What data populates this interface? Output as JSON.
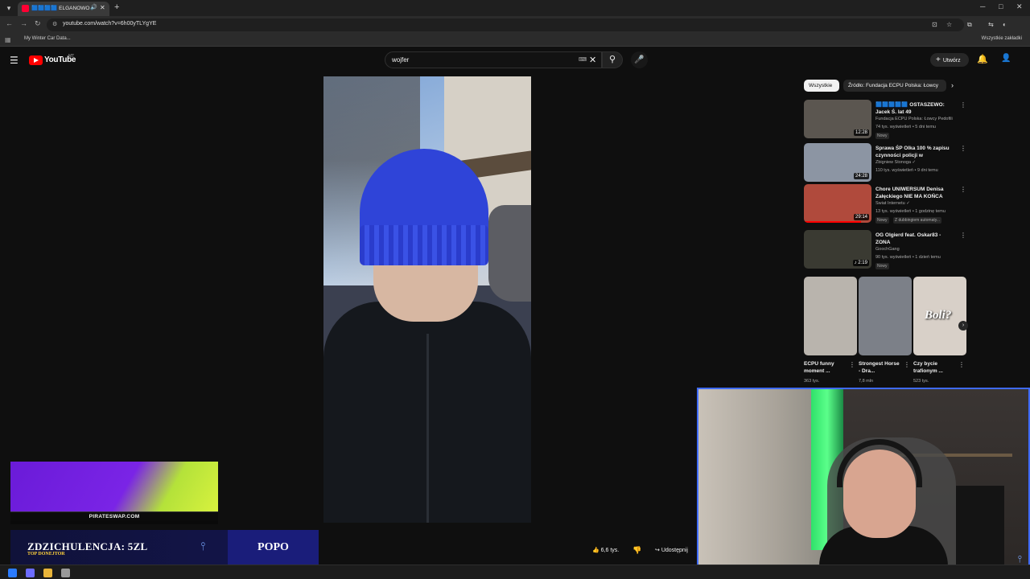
{
  "browser": {
    "tab_title": "🟦🟦🟦🟦 ELGANOWO",
    "url": "youtube.com/watch?v=6h00yTLYgYE",
    "bookmark_item": "My Winter Car Data...",
    "bookmarks_all": "Wszystkie zakładki",
    "icons": {
      "tab_menu": "▾",
      "tab_audio": "🔊",
      "tab_close": "✕",
      "new_tab": "+",
      "back": "←",
      "forward": "→",
      "reload": "↻",
      "site_info": "⚙",
      "install": "⊡",
      "star": "☆",
      "extensions": "⧉",
      "cast": "⇆",
      "profile": "◐",
      "minimize": "─",
      "maximize": "□",
      "close": "✕",
      "apps": "▦",
      "bookmark_folder": "▭"
    }
  },
  "youtube": {
    "logo_text": "YouTube",
    "country_code": "MT",
    "search_value": "wojfer",
    "create_label": "Utwórz",
    "icons": {
      "menu": "☰",
      "keyboard": "⌨",
      "clear": "✕",
      "search": "⚲",
      "mic": "🎤",
      "plus": "+",
      "bell": "🔔",
      "avatar": "👤"
    }
  },
  "actions": {
    "likes": "6,6 tys.",
    "share_label": "Udostępnij",
    "icons": {
      "like": "👍",
      "dislike": "👎",
      "share": "↪"
    }
  },
  "sidebar": {
    "chips": [
      "Wszystkie",
      "Źródło: Fundacja ECPU Polska: Łowcy"
    ],
    "chip_next_icon": "›",
    "more_icon": "⋮",
    "recommendations": [
      {
        "title": "🟦🟦🟦🟦🟦 OSTASZEWO: Jacek Ś. lat 49",
        "channel": "Fundacja ECPU Polska: Łowcy Pedofili",
        "meta": "74 tys. wyświetleń • 5 dni temu",
        "badge": "Nowy",
        "duration": "12:28",
        "thumb_color": "#5b5650"
      },
      {
        "title": "Sprawa ŚP Olka 100 % zapisu czynności policji w Grudziądzu...",
        "channel": "Zbigniew Stonoga ✓",
        "meta": "110 tys. wyświetleń • 9 dni temu",
        "badge": "",
        "duration": "24:28",
        "thumb_color": "#8c95a3"
      },
      {
        "title": "Chore UNIWERSUM Denisa Załęckiego NIE MA KOŃCA",
        "channel": "Świat Internetu ✓",
        "meta": "13 tys. wyświetleń • 1 godzinę temu",
        "badge": "Nowy",
        "badge2": "Z dubbingiem automaty...",
        "duration": "29:14",
        "progress": 0.85,
        "thumb_color": "#b04a3c"
      },
      {
        "title": "OG Olgierd feat. Oskar83 - ZONA",
        "channel": "GoochGang",
        "meta": "90 tys. wyświetleń • 1 dzień temu",
        "badge": "Nowy",
        "duration": "♪ 2:19",
        "thumb_color": "#3a3a32"
      }
    ],
    "shorts": [
      {
        "title": "ECPU funny moment ...",
        "views": "363 tys.",
        "thumb_color": "#b9b4ad"
      },
      {
        "title": "Strongest Horse - Dra...",
        "views": "7,8 mln",
        "thumb_color": "#7c8088"
      },
      {
        "title": "Czy bycie trafionym ...",
        "views": "523 tys.",
        "thumb_color": "#d8d0c8",
        "overlay": "Boli?"
      }
    ],
    "shorts_next_icon": "›"
  },
  "overlay": {
    "ad_text": "PIRATESWAP.COM",
    "donor_title": "ZDZICHULENCJA: 5ZL",
    "donor_subtitle": "TOP DONEJTOR",
    "donor_name": "POPO",
    "donor_logo_icon": "⫯",
    "cam_logo_icon": "⫯"
  },
  "taskbar": {
    "icons": [
      {
        "name": "windows-start-icon",
        "color": "#2b7bff"
      },
      {
        "name": "discord-icon",
        "color": "#6c6cff"
      },
      {
        "name": "chrome-icon",
        "color": "#e8b43a"
      },
      {
        "name": "app-icon",
        "color": "#9a9a9a"
      }
    ]
  }
}
